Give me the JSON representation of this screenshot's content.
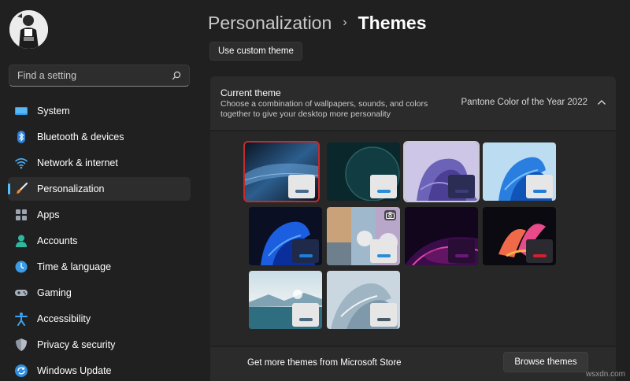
{
  "sidebar": {
    "search_placeholder": "Find a setting",
    "items": [
      {
        "label": "System",
        "icon": "system-icon"
      },
      {
        "label": "Bluetooth & devices",
        "icon": "bluetooth-icon"
      },
      {
        "label": "Network & internet",
        "icon": "wifi-icon"
      },
      {
        "label": "Personalization",
        "icon": "brush-icon",
        "active": true
      },
      {
        "label": "Apps",
        "icon": "apps-icon"
      },
      {
        "label": "Accounts",
        "icon": "account-icon"
      },
      {
        "label": "Time & language",
        "icon": "clock-globe-icon"
      },
      {
        "label": "Gaming",
        "icon": "gamepad-icon"
      },
      {
        "label": "Accessibility",
        "icon": "accessibility-icon"
      },
      {
        "label": "Privacy & security",
        "icon": "shield-icon"
      },
      {
        "label": "Windows Update",
        "icon": "update-icon"
      }
    ]
  },
  "header": {
    "parent": "Personalization",
    "separator": "›",
    "current": "Themes"
  },
  "custom_theme_button": "Use custom theme",
  "current_theme": {
    "title": "Current theme",
    "description": "Choose a combination of wallpapers, sounds, and colors together to give your desktop more personality",
    "value": "Pantone Color of the Year 2022"
  },
  "themes": [
    {
      "name": "theme-dark-blue-night",
      "accent": "#4a6a8c",
      "selected": true
    },
    {
      "name": "theme-dark-planet",
      "accent": "#2a8bd6"
    },
    {
      "name": "theme-lavender-bloom",
      "accent": "#3a3f7a"
    },
    {
      "name": "theme-windows-light",
      "accent": "#1f7ed9"
    },
    {
      "name": "theme-windows-dark",
      "accent": "#1f7ed9"
    },
    {
      "name": "theme-spotlight-photo",
      "accent": "#2a8bd6"
    },
    {
      "name": "theme-glow",
      "accent": "#6a1a78"
    },
    {
      "name": "theme-captured-motion",
      "accent": "#d61f2e"
    },
    {
      "name": "theme-sunrise-lake",
      "accent": "#4b6a80"
    },
    {
      "name": "theme-flow",
      "accent": "#4a5a66"
    }
  ],
  "footer": {
    "text": "Get more themes from Microsoft Store",
    "button": "Browse themes"
  },
  "watermark": "wsxdn.com",
  "colors": {
    "background": "#202020",
    "card": "#2b2b2b",
    "accent_indicator": "#4cc2ff",
    "selected_outline": "#c42b2b"
  }
}
